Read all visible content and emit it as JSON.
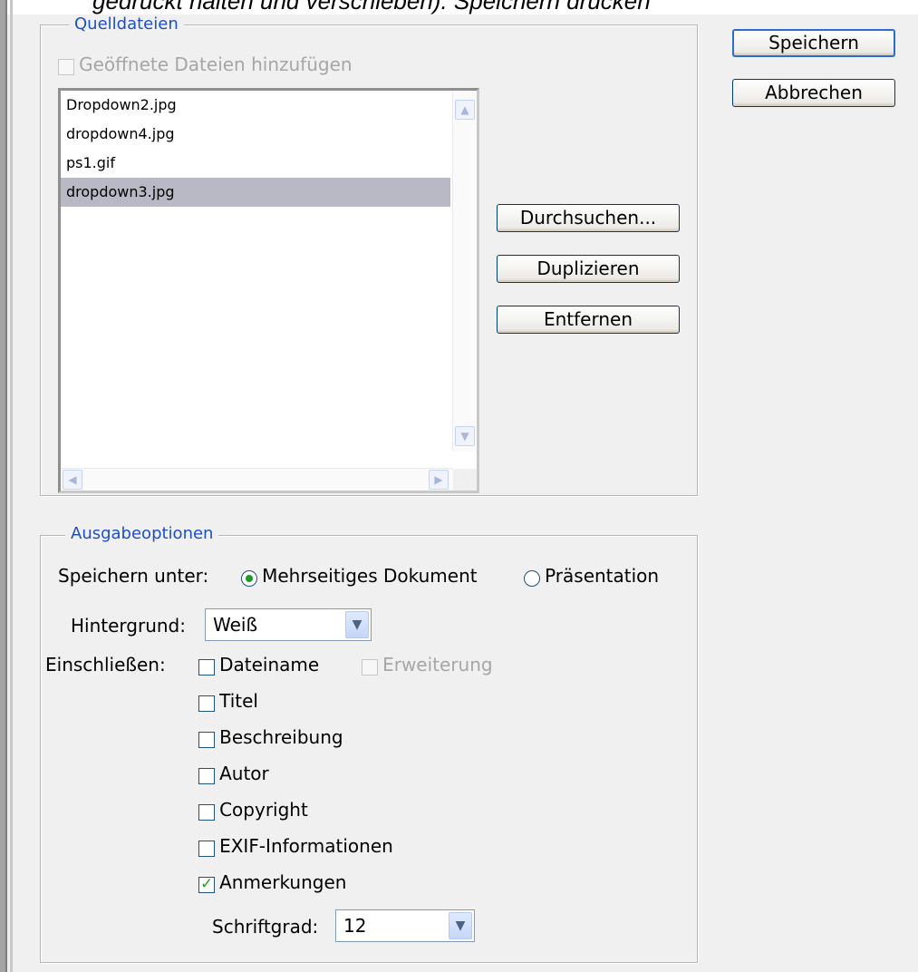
{
  "caption": {
    "text": "gedrückt halten und verschieben). Speichern drücken"
  },
  "source_files": {
    "legend": "Quelldateien",
    "add_open_files_label": "Geöffnete Dateien hinzufügen",
    "add_open_files_checked": false,
    "files": [
      "Dropdown2.jpg",
      "dropdown4.jpg",
      "ps1.gif",
      "dropdown3.jpg"
    ],
    "selected_index": 3,
    "buttons": {
      "browse": "Durchsuchen...",
      "duplicate": "Duplizieren",
      "remove": "Entfernen"
    }
  },
  "dialog_buttons": {
    "save": "Speichern",
    "cancel": "Abbrechen"
  },
  "output_options": {
    "legend": "Ausgabeoptionen",
    "save_as_label": "Speichern unter:",
    "save_as_options": [
      "Mehrseitiges Dokument",
      "Präsentation"
    ],
    "save_as_selected": "Mehrseitiges Dokument",
    "background_label": "Hintergrund:",
    "background_value": "Weiß",
    "include_label": "Einschließen:",
    "include": {
      "filename": {
        "label": "Dateiname",
        "checked": false
      },
      "extension": {
        "label": "Erweiterung",
        "checked": false,
        "disabled": true
      },
      "title": {
        "label": "Titel",
        "checked": false
      },
      "description": {
        "label": "Beschreibung",
        "checked": false
      },
      "author": {
        "label": "Autor",
        "checked": false
      },
      "copyright": {
        "label": "Copyright",
        "checked": false
      },
      "exif": {
        "label": "EXIF-Informationen",
        "checked": false
      },
      "annotations": {
        "label": "Anmerkungen",
        "checked": true
      }
    },
    "font_size_label": "Schriftgrad:",
    "font_size_value": "12"
  },
  "icons": {
    "scroll_up": "scroll-up-arrow",
    "scroll_down": "scroll-down-arrow",
    "scroll_left": "scroll-left-arrow",
    "scroll_right": "scroll-right-arrow",
    "dropdown": "chevron-down"
  },
  "colors": {
    "legend_text": "#1c4fc7",
    "selection": "#b9b9c6",
    "check_mark": "#21a121",
    "radio_dot": "#1e9a22"
  }
}
